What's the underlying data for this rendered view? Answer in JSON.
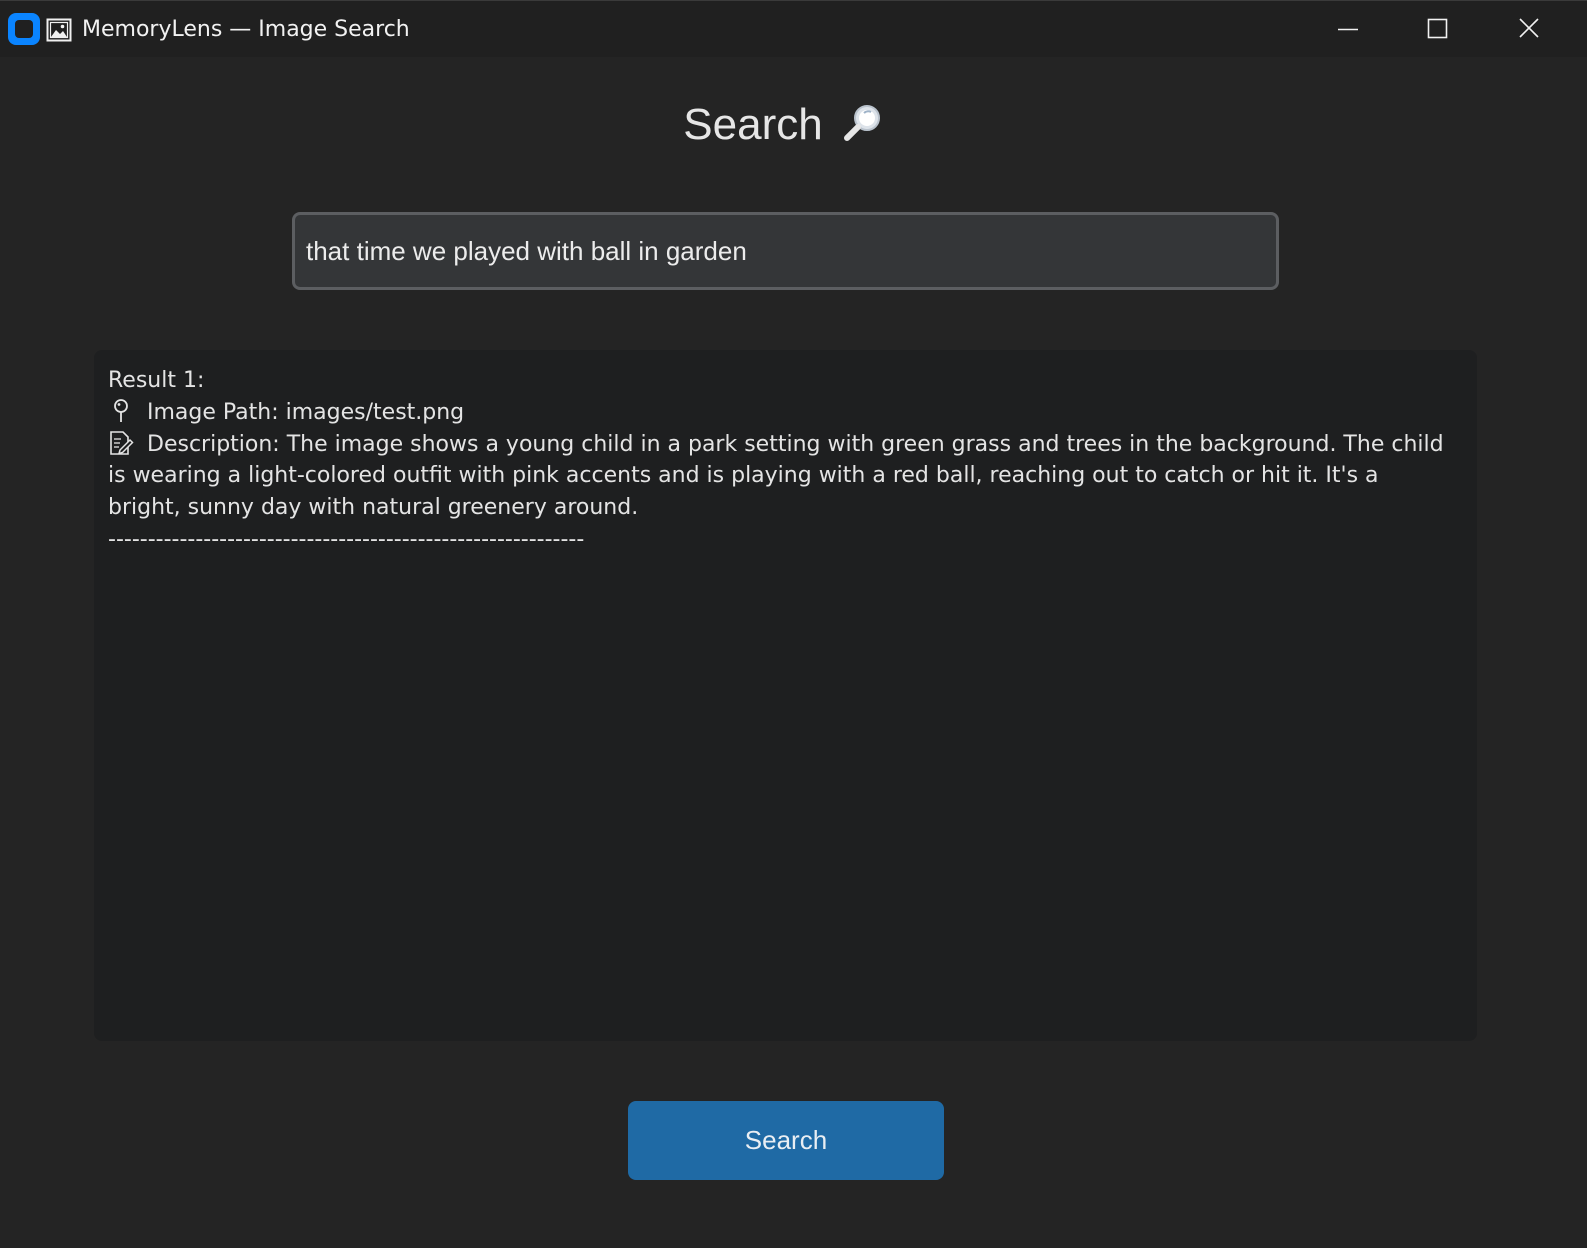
{
  "window": {
    "title": "MemoryLens — Image Search"
  },
  "icons": {
    "app": "app-icon",
    "image": "picture-icon",
    "heading": "magnifying-glass-icon",
    "path": "pin-icon",
    "description": "memo-icon"
  },
  "heading": {
    "text": "Search"
  },
  "search": {
    "value": "that time we played with ball in garden",
    "button_label": "Search"
  },
  "results": {
    "label": "Result 1:",
    "image_path": "Image Path: images/test.png",
    "description": "Description: The image shows a young child in a park setting with green grass and trees in the background. The child is wearing a light-colored outfit with pink accents and is playing with a red ball, reaching out to catch or hit it. It's a bright, sunny day with natural greenery around.",
    "divider": "------------------------------------------------------------"
  },
  "colors": {
    "background": "#242424",
    "titlebar": "#202020",
    "panel": "#1e1f20",
    "input_bg": "#343638",
    "input_border": "#5c5e61",
    "accent": "#1f6aa5",
    "app_icon": "#0a84ff"
  }
}
